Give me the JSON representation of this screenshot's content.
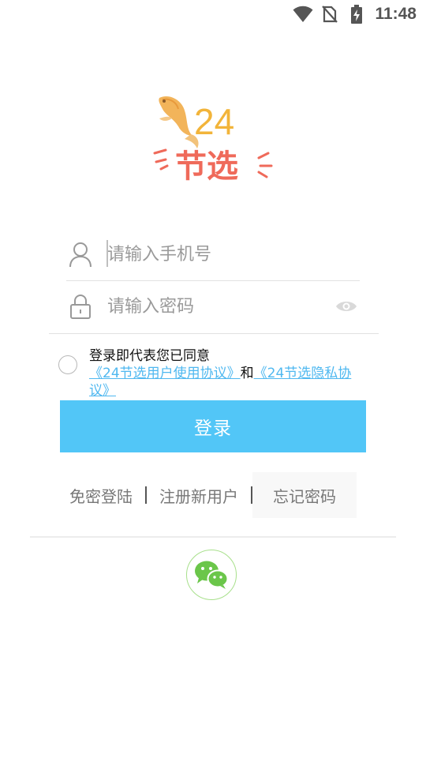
{
  "status_bar": {
    "time": "11:48",
    "icons": [
      "wifi-icon",
      "no-sim-icon",
      "battery-charging-icon"
    ]
  },
  "logo": {
    "number": "24",
    "text": "节选",
    "icon": "koi-fish-icon"
  },
  "login_form": {
    "phone_placeholder": "请输入手机号",
    "phone_value": "",
    "password_placeholder": "请输入密码",
    "password_value": "",
    "user_icon": "user-icon",
    "lock_icon": "lock-icon",
    "eye_icon": "eye-icon"
  },
  "agreement": {
    "checked": false,
    "prefix": "登录即代表您已同意",
    "user_agreement": "《24节选用户使用协议》",
    "conjunction": "和",
    "privacy_policy": "《24节选隐私协议》"
  },
  "login_button": "登录",
  "links": {
    "passwordless": "免密登陆",
    "register": "注册新用户",
    "forgot": "忘记密码"
  },
  "social": {
    "wechat_icon": "wechat-icon"
  },
  "colors": {
    "accent": "#52c6f7",
    "link": "#4fb8f0",
    "wechat": "#6bc64a"
  }
}
